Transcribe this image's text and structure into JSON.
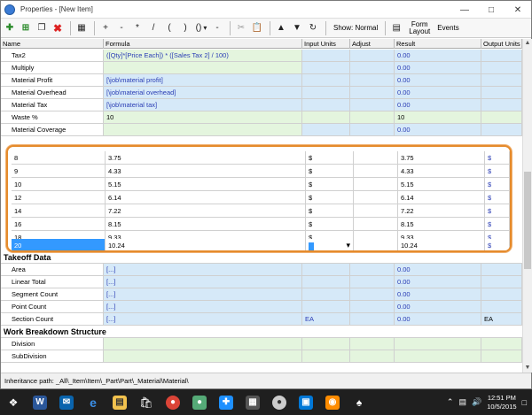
{
  "window": {
    "title": "Properties - [New Item]"
  },
  "toolbar": {
    "ops": [
      "+",
      "-",
      "*",
      "/",
      "(",
      ")",
      "()",
      "-"
    ],
    "show_label": "Show: Normal",
    "form_layout_line1": "Form",
    "form_layout_line2": "Layout",
    "events_label": "Events"
  },
  "columns": [
    "Name",
    "Formula",
    "Input Units",
    "Adjust",
    "Result",
    "Output Units"
  ],
  "rows_top": [
    {
      "name": "Tax2",
      "formula": "([Qty]*[Price Each]) * ([Sales Tax 2] / 100)",
      "input": "",
      "adjust": "",
      "result": "0.00",
      "output": ""
    },
    {
      "name": "Multiply",
      "formula": "",
      "input": "",
      "adjust": "",
      "result": "0.00",
      "output": ""
    },
    {
      "name": "Material Profit",
      "formula": "[\\job\\material profit]",
      "input": "",
      "adjust": "",
      "result": "0.00",
      "output": ""
    },
    {
      "name": "Material Overhead",
      "formula": "[\\job\\material overhead]",
      "input": "",
      "adjust": "",
      "result": "0.00",
      "output": ""
    },
    {
      "name": "Material Tax",
      "formula": "[\\job\\material tax]",
      "input": "",
      "adjust": "",
      "result": "0.00",
      "output": ""
    },
    {
      "name": "Waste %",
      "formula": "10",
      "input": "",
      "adjust": "",
      "result": "10",
      "output": ""
    },
    {
      "name": "Material Coverage",
      "formula": "",
      "input": "",
      "adjust": "",
      "result": "0.00",
      "output": ""
    }
  ],
  "popup_rows": [
    {
      "name": "8",
      "formula": "3.75",
      "input": "$",
      "adjust": "",
      "result": "3.75",
      "output": "$"
    },
    {
      "name": "9",
      "formula": "4.33",
      "input": "$",
      "adjust": "",
      "result": "4.33",
      "output": "$"
    },
    {
      "name": "10",
      "formula": "5.15",
      "input": "$",
      "adjust": "",
      "result": "5.15",
      "output": "$"
    },
    {
      "name": "12",
      "formula": "6.14",
      "input": "$",
      "adjust": "",
      "result": "6.14",
      "output": "$"
    },
    {
      "name": "14",
      "formula": "7.22",
      "input": "$",
      "adjust": "",
      "result": "7.22",
      "output": "$"
    },
    {
      "name": "16",
      "formula": "8.15",
      "input": "$",
      "adjust": "",
      "result": "8.15",
      "output": "$"
    },
    {
      "name": "18",
      "formula": "9.33",
      "input": "$",
      "adjust": "",
      "result": "9.33",
      "output": "$"
    },
    {
      "name": "20",
      "formula": "10.24",
      "input": "",
      "adjust": "",
      "result": "10.24",
      "output": "$"
    }
  ],
  "takeoff": {
    "section": "Takeoff Data",
    "rows": [
      {
        "name": "Area",
        "formula": "[...]",
        "input": "",
        "adjust": "",
        "result": "0.00",
        "output": ""
      },
      {
        "name": "Linear Total",
        "formula": "[...]",
        "input": "",
        "adjust": "",
        "result": "0.00",
        "output": ""
      },
      {
        "name": "Segment Count",
        "formula": "[...]",
        "input": "",
        "adjust": "",
        "result": "0.00",
        "output": ""
      },
      {
        "name": "Point Count",
        "formula": "[...]",
        "input": "",
        "adjust": "",
        "result": "0.00",
        "output": ""
      },
      {
        "name": "Section Count",
        "formula": "[...]",
        "input": "EA",
        "adjust": "",
        "result": "0.00",
        "output": "EA"
      }
    ]
  },
  "wbs": {
    "section": "Work Breakdown Structure",
    "rows": [
      {
        "name": "Division"
      },
      {
        "name": "SubDivision"
      }
    ]
  },
  "status": {
    "inheritance": "Inheritance path:  _All\\_Item\\Item\\_Part\\Part\\_Material\\Material\\"
  },
  "taskbar": {
    "time": "12:51 PM",
    "date": "10/5/2015"
  }
}
